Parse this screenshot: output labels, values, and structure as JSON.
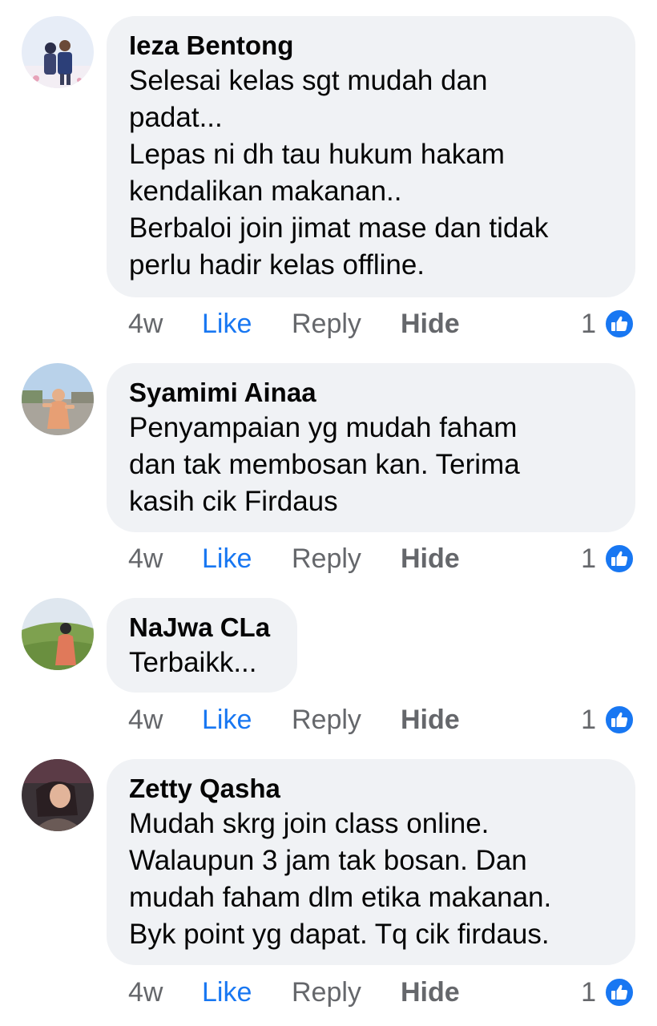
{
  "comments": [
    {
      "author": "Ieza Bentong",
      "lines": [
        "Selesai kelas sgt mudah dan",
        "padat...",
        "Lepas ni dh tau hukum hakam",
        "kendalikan makanan..",
        "Berbaloi join jimat mase dan tidak",
        "perlu hadir kelas offline."
      ],
      "time": "4w",
      "like_label": "Like",
      "reply_label": "Reply",
      "hide_label": "Hide",
      "reaction_count": "1",
      "reaction_icon": "like-reaction-icon"
    },
    {
      "author": "Syamimi Ainaa",
      "lines": [
        "Penyampaian yg mudah faham",
        "dan tak membosan kan. Terima",
        "kasih cik Firdaus"
      ],
      "time": "4w",
      "like_label": "Like",
      "reply_label": "Reply",
      "hide_label": "Hide",
      "reaction_count": "1",
      "reaction_icon": "like-reaction-icon"
    },
    {
      "author": "NaJwa CLa",
      "lines": [
        "Terbaikk..."
      ],
      "time": "4w",
      "like_label": "Like",
      "reply_label": "Reply",
      "hide_label": "Hide",
      "reaction_count": "1",
      "reaction_icon": "like-reaction-icon"
    },
    {
      "author": "Zetty Qasha",
      "lines": [
        "Mudah skrg join class online.",
        "Walaupun 3 jam tak bosan. Dan",
        "mudah faham dlm etika makanan.",
        "Byk point yg dapat. Tq cik firdaus."
      ],
      "time": "4w",
      "like_label": "Like",
      "reply_label": "Reply",
      "hide_label": "Hide",
      "reaction_count": "1",
      "reaction_icon": "like-reaction-icon"
    }
  ],
  "colors": {
    "bubble_bg": "#f0f2f5",
    "like_blue": "#1877f2",
    "meta_gray": "#65676b",
    "text": "#050505"
  }
}
